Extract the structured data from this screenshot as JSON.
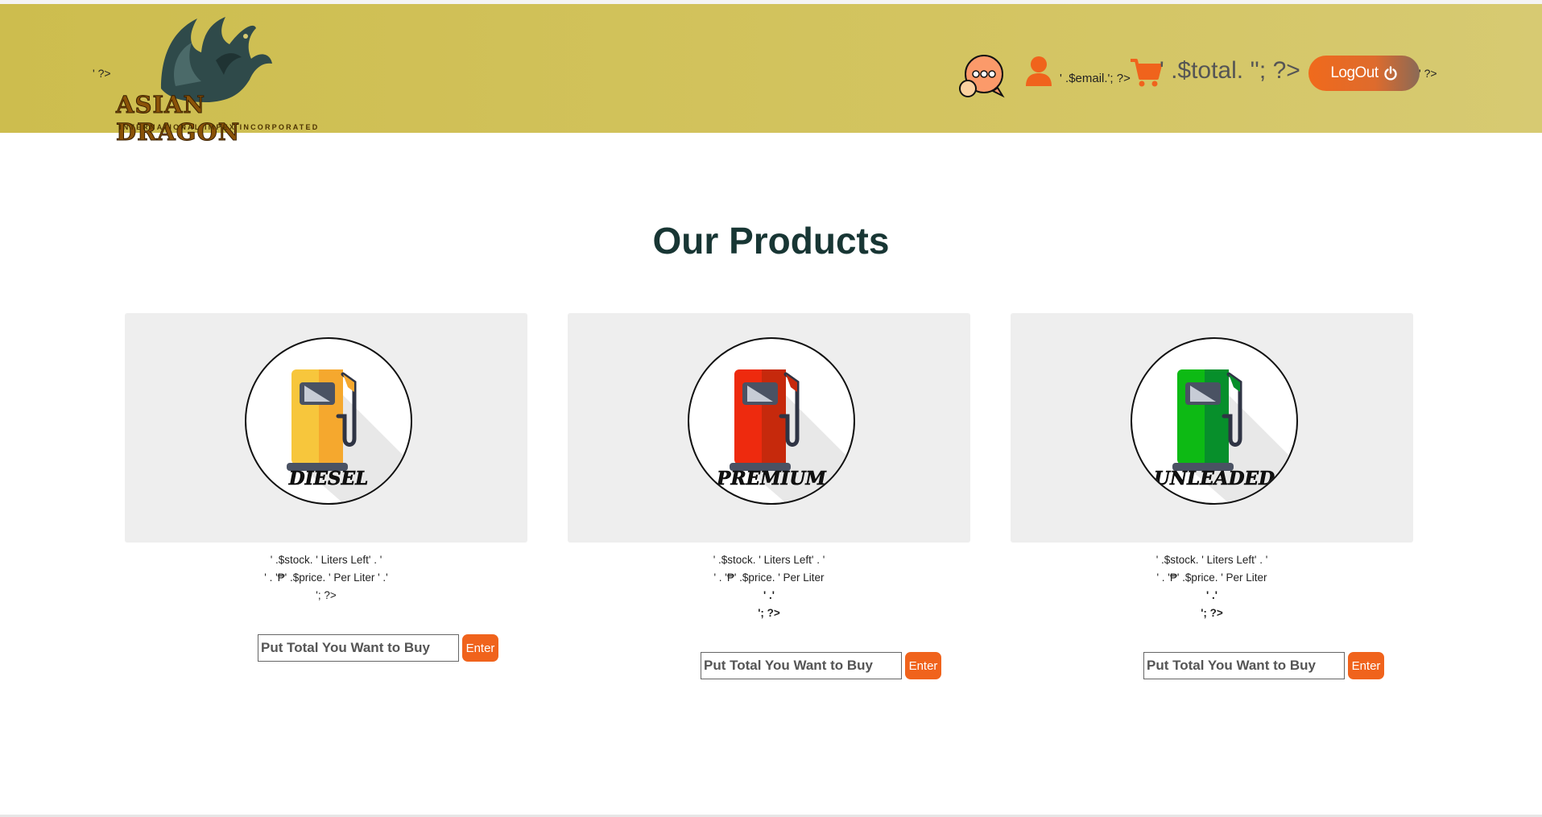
{
  "header": {
    "php_left": "' ?>",
    "logo": {
      "name": "ASIAN DRAGON",
      "tagline": "INTERNATIONAL IMPEX INCORPORATED"
    },
    "email_text": "' .$email.'; ?>",
    "total_text": "' .$total. ''; ?>",
    "logout_label": "LogOut",
    "php_right": "' ?>",
    "icons": [
      "chat-icon",
      "user-icon",
      "cart-icon",
      "power-icon"
    ]
  },
  "main": {
    "title": "Our Products",
    "products": [
      {
        "label": "DIESEL",
        "color": "#f7c63c",
        "stock_line": "' .$stock. ' Liters Left' . '",
        "price_line": "' . '₱' .$price. ' Per Liter ' .'",
        "extra_line": "'; ?>",
        "input_placeholder": "Put Total You Want to Buy",
        "button_label": "Enter"
      },
      {
        "label": "PREMIUM",
        "color": "#ee2a0e",
        "stock_line": "' .$stock. ' Liters Left' . '",
        "price_line": "' . '₱' .$price. ' Per Liter",
        "extra_line": "' .'",
        "extra_line_2": "'; ?>",
        "input_placeholder": "Put Total You Want to Buy",
        "button_label": "Enter"
      },
      {
        "label": "UNLEADED",
        "color": "#0dba14",
        "stock_line": "' .$stock. ' Liters Left' . '",
        "price_line": "' . '₱' .$price. ' Per Liter",
        "extra_line": "' .'",
        "extra_line_2": "'; ?>",
        "input_placeholder": "Put Total You Want to Buy",
        "button_label": "Enter"
      }
    ]
  },
  "colors": {
    "header": "#cdbd4e",
    "accent": "#f0631c",
    "title": "#183634",
    "card": "#eeeeee"
  }
}
